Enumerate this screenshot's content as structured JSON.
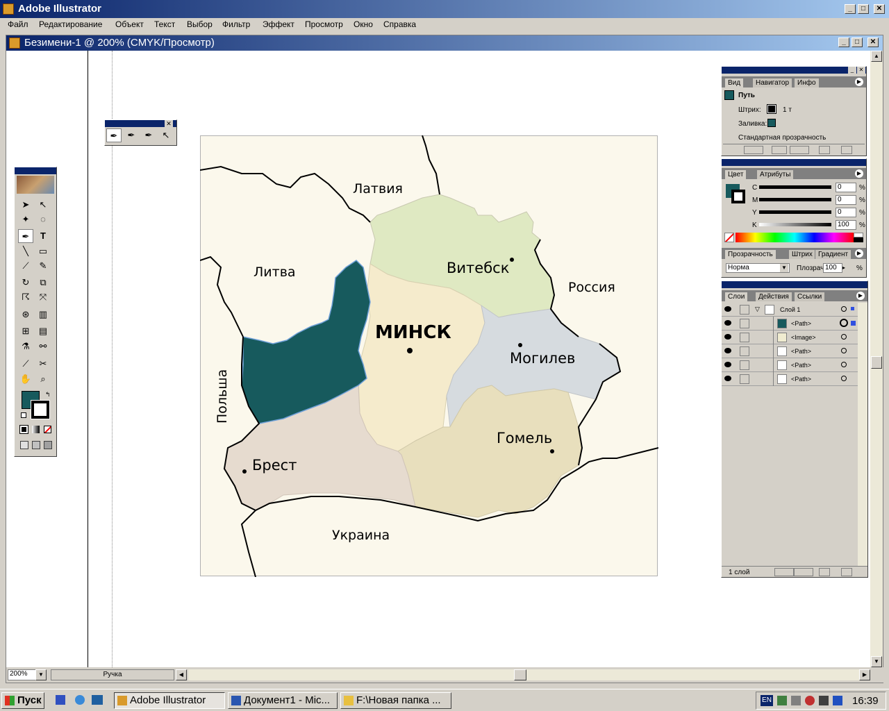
{
  "app": {
    "title": "Adobe Illustrator"
  },
  "menu": [
    "Файл",
    "Редактирование",
    "Объект",
    "Текст",
    "Выбор",
    "Фильтр",
    "Эффект",
    "Просмотр",
    "Окно",
    "Справка"
  ],
  "document": {
    "title": "Безимени-1 @ 200% (CMYK/Просмотр)"
  },
  "status": {
    "zoom": "200%",
    "tool": "Ручка"
  },
  "map": {
    "labels": {
      "latvia": "Латвия",
      "lithuania": "Литва",
      "russia": "Россия",
      "poland": "Польша",
      "ukraine": "Украина",
      "minsk": "МИНСК",
      "vitebsk": "Витебск",
      "mogilev": "Могилев",
      "gomel": "Гомель",
      "brest": "Брест"
    },
    "colors": {
      "vitebsk": "#dfe9c2",
      "minsk": "#f5ebcc",
      "mogilev": "#d6dbdf",
      "gomel": "#e8dfbd",
      "brest": "#e6dbcf",
      "grodno": "#175a5d",
      "background": "#fbf8ec"
    }
  },
  "info_panel": {
    "tabs": [
      "Вид",
      "Навигатор",
      "Инфо"
    ],
    "object": "Путь",
    "stroke_label": "Штрих:",
    "stroke_value": "1 т",
    "fill_label": "Заливка:",
    "transparency_label": "Стандартная прозрачность"
  },
  "color_panel": {
    "tabs": [
      "Цвет",
      "Атрибуты"
    ],
    "channels": [
      {
        "name": "C",
        "value": "0"
      },
      {
        "name": "M",
        "value": "0"
      },
      {
        "name": "Y",
        "value": "0"
      },
      {
        "name": "K",
        "value": "100"
      }
    ]
  },
  "transparency_panel": {
    "tabs": [
      "Прозрачность",
      "Штрих",
      "Градиент"
    ],
    "mode": "Норма",
    "opacity_label": "Плозрач",
    "opacity_value": "100",
    "percent": "%"
  },
  "layers_panel": {
    "tabs": [
      "Слои",
      "Действия",
      "Ссылки"
    ],
    "layer_name": "Слой 1",
    "items": [
      "<Path>",
      "<Image>",
      "<Path>",
      "<Path>",
      "<Path>"
    ],
    "footer": "1 слой"
  },
  "taskbar": {
    "start": "Пуск",
    "buttons": [
      "Adobe Illustrator",
      "Документ1 - Mic...",
      "F:\\Новая папка ..."
    ],
    "lang": "EN",
    "clock": "16:39"
  }
}
